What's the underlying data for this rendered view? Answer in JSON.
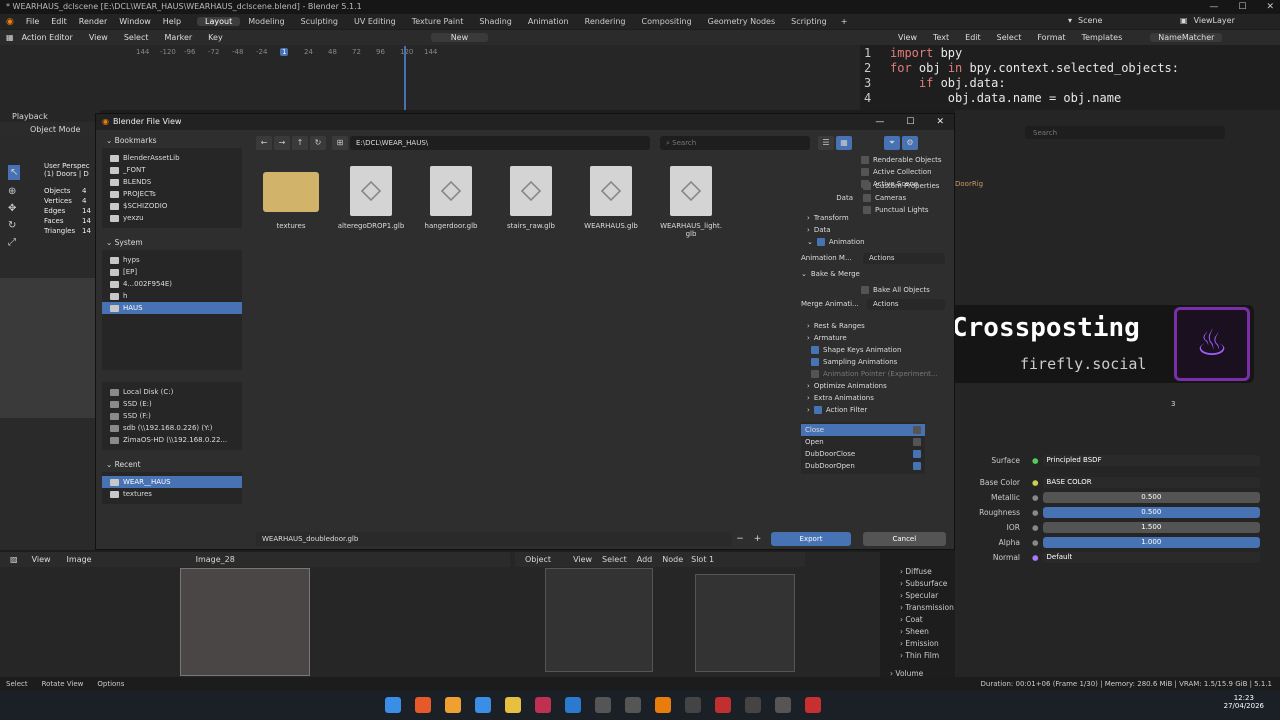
{
  "window": {
    "title": "* WEARHAUS_dclscene [E:\\DCL\\WEAR_HAUS\\WEARHAUS_dclscene.blend] - Blender 5.1.1"
  },
  "topmenu": [
    "File",
    "Edit",
    "Render",
    "Window",
    "Help"
  ],
  "workspaces": [
    "Layout",
    "Modeling",
    "Sculpting",
    "UV Editing",
    "Texture Paint",
    "Shading",
    "Animation",
    "Rendering",
    "Compositing",
    "Geometry Nodes",
    "Scripting"
  ],
  "scene": {
    "scene_label": "Scene",
    "viewlayer_label": "ViewLayer"
  },
  "action_editor": {
    "mode": "Action Editor",
    "menus": [
      "View",
      "Select",
      "Marker",
      "Key"
    ],
    "new_label": "New",
    "ticks": [
      "144",
      "-120",
      "-96",
      "-72",
      "-48",
      "-24",
      "1",
      "24",
      "48",
      "72",
      "96",
      "120",
      "144"
    ]
  },
  "text_editor": {
    "menus": [
      "View",
      "Text",
      "Edit",
      "Select",
      "Format",
      "Templates"
    ],
    "filename": "NameMatcher",
    "lines": [
      "1",
      "2",
      "3",
      "4"
    ]
  },
  "viewport": {
    "mode": "Object Mode",
    "playback": "Playback",
    "stats_title": "User Perspec",
    "stats_sub": "(1) Doors | D",
    "stats": [
      {
        "k": "Objects",
        "v": "4"
      },
      {
        "k": "Vertices",
        "v": "4"
      },
      {
        "k": "Edges",
        "v": "14"
      },
      {
        "k": "Faces",
        "v": "14"
      },
      {
        "k": "Triangles",
        "v": "14"
      }
    ]
  },
  "dialog": {
    "title": "Blender File View",
    "bookmarks_label": "Bookmarks",
    "bookmarks": [
      "BlenderAssetLib",
      "_FONT",
      "BLENDS",
      "PROJECTs",
      "$SCHIZODIO",
      "yexzu"
    ],
    "system_label": "System",
    "system": [
      "hyps",
      "[EP]",
      "4...002F954E)",
      "h",
      "HAUS"
    ],
    "volumes": [
      "Local Disk (C:)",
      "SSD (E:)",
      "SSD (F:)",
      "sdb (\\\\192.168.0.226) (Y:)",
      "ZimaOS-HD (\\\\192.168.0.22..."
    ],
    "recent_label": "Recent",
    "recent": [
      "WEAR__HAUS",
      "textures"
    ],
    "path": "E:\\DCL\\WEAR_HAUS\\",
    "search_placeholder": "Search",
    "files": [
      "textures",
      "alteregoDROP1.glb",
      "hangerdoor.glb",
      "stairs_raw.glb",
      "WEARHAUS.glb",
      "WEARHAUS_light.\nglb"
    ],
    "filename": "WEARHAUS_doubledoor.glb",
    "export_label": "Export",
    "cancel_label": "Cancel"
  },
  "options": {
    "include": [
      "Renderable Objects",
      "Active Collection",
      "Active Scene"
    ],
    "data_label": "Data",
    "data": [
      "Custom Properties",
      "Cameras",
      "Punctual Lights"
    ],
    "sections": [
      "Transform",
      "Data",
      "Animation"
    ],
    "anim_mode_label": "Animation M...",
    "anim_mode_value": "Actions",
    "bake_label": "Bake & Merge",
    "bake_all": "Bake All Objects",
    "merge_label": "Merge Animati...",
    "merge_value": "Actions",
    "more": [
      "Rest & Ranges",
      "Armature",
      "Shape Keys Animation",
      "Sampling Animations",
      "Animation Pointer (Experiment...",
      "Optimize Animations",
      "Extra Animations",
      "Action Filter"
    ],
    "actions": [
      "Close",
      "Open",
      "DubDoorClose",
      "DubDoorOpen"
    ]
  },
  "overlay": {
    "title": "Crossposting",
    "subtitle": "firefly.social"
  },
  "material": {
    "surface_label": "Surface",
    "surface_value": "Principled BSDF",
    "base_label": "Base Color",
    "base_value": "BASE COLOR",
    "props": [
      {
        "k": "Metallic",
        "v": "0.500"
      },
      {
        "k": "Roughness",
        "v": "0.500"
      },
      {
        "k": "IOR",
        "v": "1.500"
      },
      {
        "k": "Alpha",
        "v": "1.000"
      }
    ],
    "normal_label": "Normal",
    "normal_value": "Default",
    "slot_count": "3",
    "sections": [
      "Diffuse",
      "Subsurface",
      "Specular",
      "Transmission",
      "Coat",
      "Sheen",
      "Emission",
      "Thin Film"
    ],
    "volume": "Volume"
  },
  "outliner": {
    "search_placeholder": "Search",
    "item": "DoorRig"
  },
  "image_editor": {
    "menus": [
      "View",
      "Image"
    ],
    "image": "Image_28"
  },
  "node_editor": {
    "mode": "Object",
    "menus": [
      "View",
      "Select",
      "Add",
      "Node"
    ],
    "slot": "Slot 1"
  },
  "status": {
    "left": [
      "Select",
      "Rotate View",
      "Options"
    ],
    "right": "Duration: 00:01+06 (Frame 1/30) | Memory: 280.6 MiB | VRAM: 1.5/15.9 GiB | 5.1.1"
  },
  "clock": {
    "time": "12:23",
    "date": "27/04/2026"
  },
  "colors": {
    "accent": "#4772b3",
    "folder": "#d1b36a",
    "overlay_border": "#7a2fa8"
  }
}
